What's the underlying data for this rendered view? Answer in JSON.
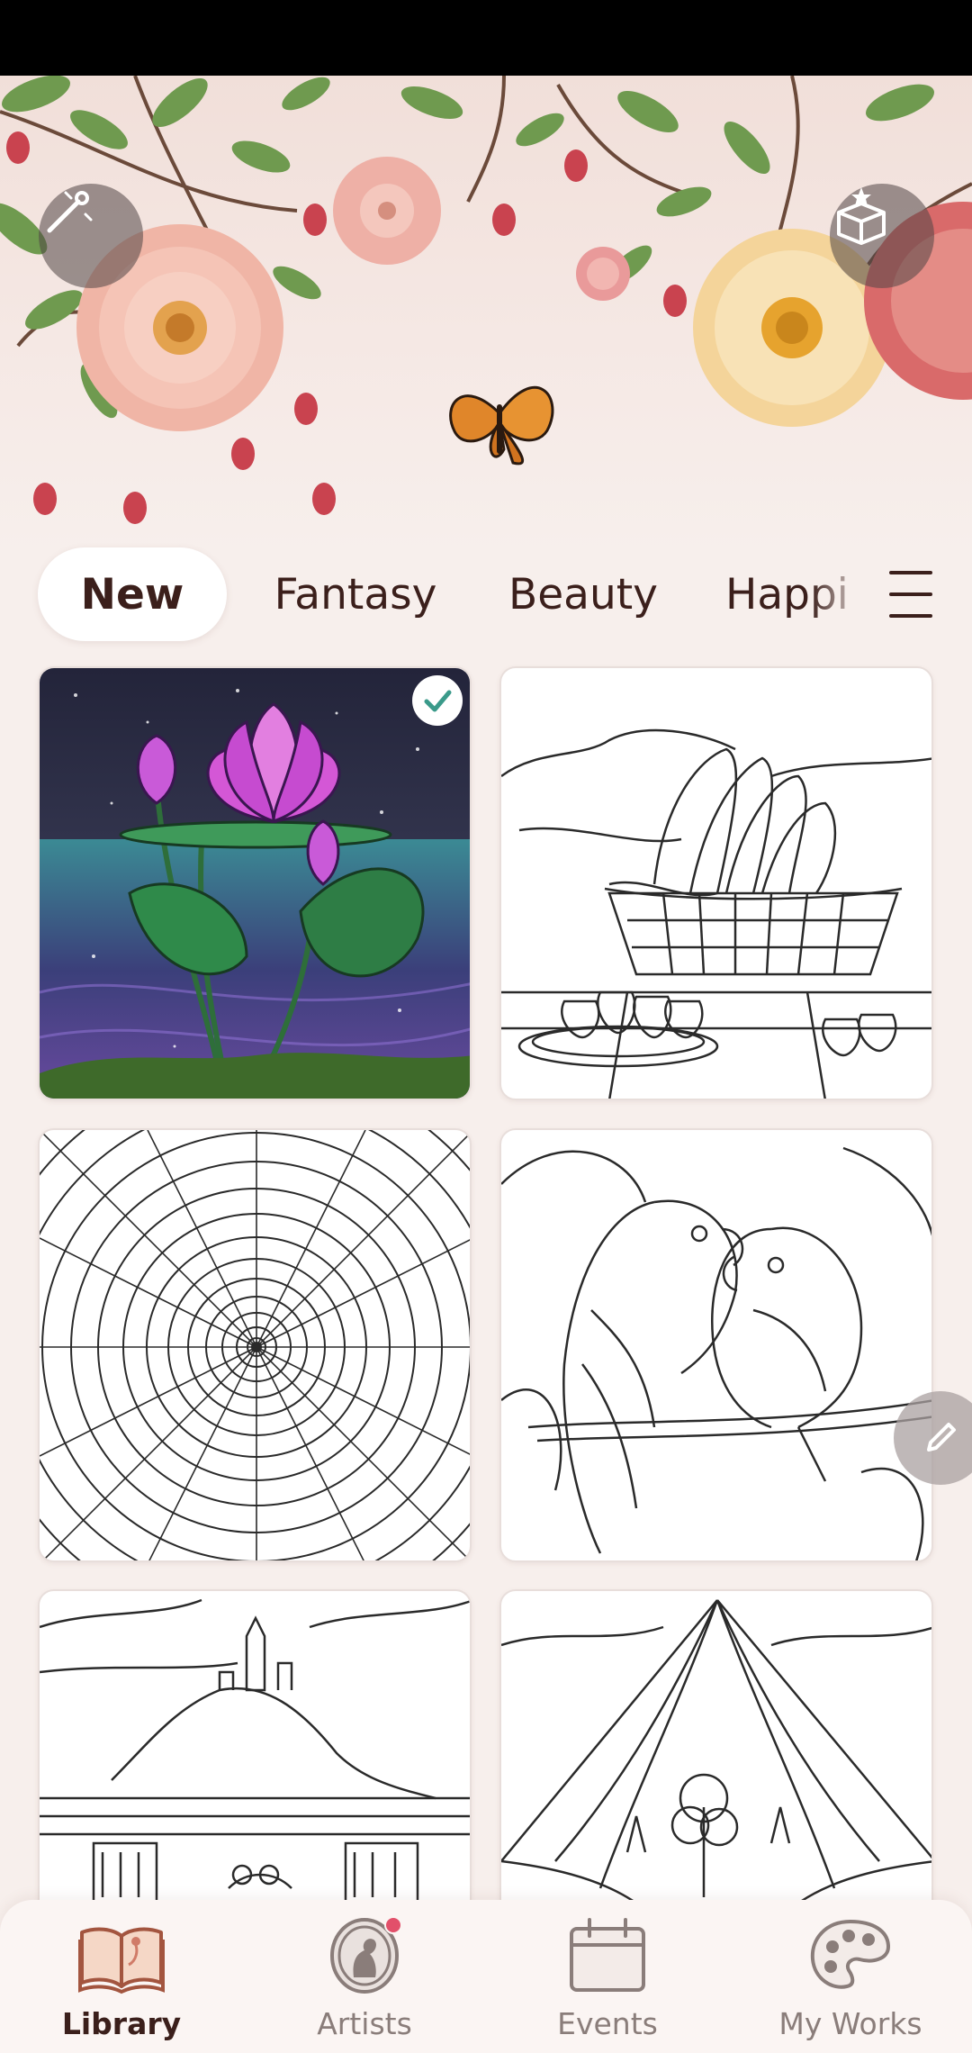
{
  "tabs": [
    {
      "label": "New",
      "active": true
    },
    {
      "label": "Fantasy",
      "active": false
    },
    {
      "label": "Beauty",
      "active": false
    },
    {
      "label": "Happi",
      "active": false
    }
  ],
  "artworks": [
    {
      "name": "lotus-night",
      "colored": true,
      "completed": true
    },
    {
      "name": "banana-basket",
      "colored": false,
      "completed": false
    },
    {
      "name": "circular-brick-mandala",
      "colored": false,
      "completed": false
    },
    {
      "name": "parrots-pair",
      "colored": false,
      "completed": false
    },
    {
      "name": "island-castle",
      "colored": false,
      "completed": false
    },
    {
      "name": "tent-view",
      "colored": false,
      "completed": false
    }
  ],
  "nav": [
    {
      "label": "Library",
      "icon": "open-book-icon",
      "active": true
    },
    {
      "label": "Artists",
      "icon": "artist-portrait-icon",
      "active": false,
      "has_notification": true
    },
    {
      "label": "Events",
      "icon": "calendar-icon",
      "active": false
    },
    {
      "label": "My Works",
      "icon": "palette-icon",
      "active": false
    }
  ],
  "colors": {
    "background": "#f7efec",
    "tab_text": "#3b1f1b",
    "nav_inactive": "#8a7d7a",
    "notification": "#e2506a",
    "check": "#3a9a8a"
  }
}
